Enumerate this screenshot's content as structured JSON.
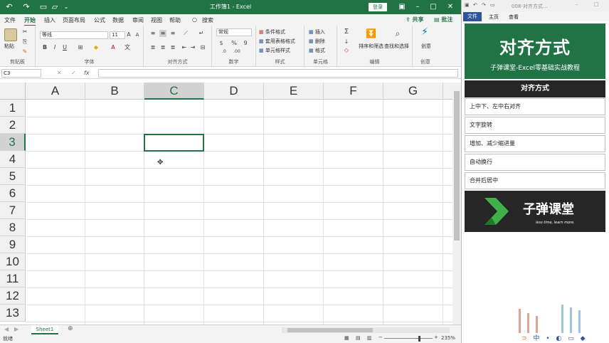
{
  "excel": {
    "title": "工作簿1 - Excel",
    "login_label": "登录",
    "menu": [
      "文件",
      "开始",
      "插入",
      "页面布局",
      "公式",
      "数据",
      "审阅",
      "视图",
      "帮助"
    ],
    "search_label": "搜索",
    "share_label": "共享",
    "comment_label": "批注",
    "ribbon": {
      "paste_label": "粘贴",
      "clipboard_group": "剪贴板",
      "font_name": "等线",
      "font_size": "11",
      "font_group": "字体",
      "bold": "B",
      "italic": "I",
      "underline": "U",
      "align_group": "对齐方式",
      "number_format": "常规",
      "number_group": "数字",
      "percent": "%",
      "comma": "9",
      "conditional_format": "条件格式",
      "table_format": "套用表格格式",
      "cell_style": "单元格样式",
      "styles_group": "样式",
      "insert": "插入",
      "delete": "删除",
      "format": "格式",
      "cells_group": "单元格",
      "sort_filter": "排序和筛选",
      "find_select": "查找和选择",
      "edit_group": "编辑",
      "idea": "创意",
      "idea_group": "创意"
    },
    "name_box": "C3",
    "fx": "fx",
    "columns": [
      "A",
      "B",
      "C",
      "D",
      "E",
      "F",
      "G"
    ],
    "selected_column": "C",
    "rows": [
      "1",
      "2",
      "3",
      "4",
      "5",
      "6",
      "7",
      "8",
      "9",
      "10",
      "11",
      "12",
      "13"
    ],
    "selected_row": "3",
    "sheet_tab": "Sheet1",
    "status": "就绪",
    "zoom": "235%"
  },
  "panel": {
    "window_title": "008-对齐方式...",
    "menu": [
      "文件",
      "主页",
      "查看"
    ],
    "slide_title": "对齐方式",
    "slide_subtitle": "子弹课堂-Excel零基础实战教程",
    "section_heading": "对齐方式",
    "items": [
      "上中下、左中右对齐",
      "文字旋转",
      "增加、减少缩进量",
      "自动换行",
      "合并后居中"
    ],
    "brand_name": "子弹课堂",
    "brand_slogan": "less time, learn more."
  },
  "colors": {
    "excel_green": "#217346",
    "dark": "#262626"
  }
}
